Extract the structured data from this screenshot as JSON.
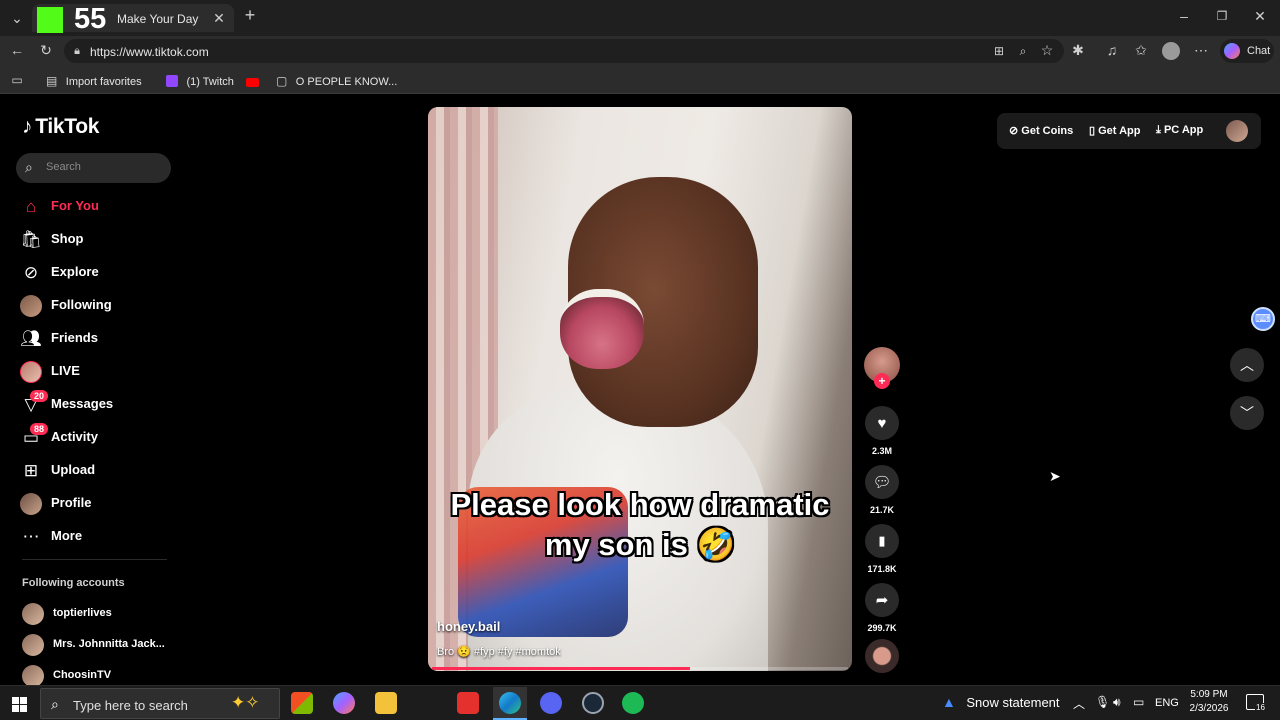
{
  "browser": {
    "tab_title": "Make Your Day",
    "overlay_number": "55",
    "url": "https://www.tiktok.com",
    "chat_label": "Chat",
    "favorites": [
      {
        "label": "Import favorites"
      },
      {
        "label": "(1) Twitch"
      },
      {
        "label": ""
      },
      {
        "label": "O PEOPLE KNOW..."
      }
    ]
  },
  "sidebar": {
    "logo": "TikTok",
    "search_placeholder": "Search",
    "nav": [
      {
        "label": "For You",
        "icon": "home-icon",
        "active": true
      },
      {
        "label": "Shop",
        "icon": "shop-icon"
      },
      {
        "label": "Explore",
        "icon": "compass-icon"
      },
      {
        "label": "Following",
        "icon": "avatar-icon"
      },
      {
        "label": "Friends",
        "icon": "friends-icon"
      },
      {
        "label": "LIVE",
        "icon": "live-avatar-icon"
      },
      {
        "label": "Messages",
        "icon": "messages-icon",
        "badge": "20"
      },
      {
        "label": "Activity",
        "icon": "activity-icon",
        "badge": "88"
      },
      {
        "label": "Upload",
        "icon": "upload-icon"
      },
      {
        "label": "Profile",
        "icon": "profile-avatar-icon"
      },
      {
        "label": "More",
        "icon": "more-icon"
      }
    ],
    "following_header": "Following accounts",
    "following": [
      {
        "name": "toptierlives"
      },
      {
        "name": "Mrs. Johnnitta Jack..."
      },
      {
        "name": "ChoosinTV"
      }
    ]
  },
  "video": {
    "caption_line1": "Please look how dramatic",
    "caption_line2": "my son is 🤣",
    "author": "honey.bail",
    "description": "Bro 😟 #fyp #fy #momtok",
    "progress": 0.62
  },
  "actions": {
    "likes": "2.3M",
    "comments": "21.7K",
    "saves": "171.8K",
    "shares": "299.7K"
  },
  "header": {
    "get_coins": "Get Coins",
    "get_app": "Get App",
    "pc_app": "PC App"
  },
  "taskbar": {
    "search_placeholder": "Type here to search",
    "weather": "Snow statement",
    "language": "ENG",
    "time": "5:09 PM",
    "date": "2/3/2026",
    "notification_count": "16"
  },
  "colors": {
    "accent": "#fe2c55",
    "chrome_dark": "#1f1f1f",
    "chrome_mid": "#2c2c2c"
  }
}
